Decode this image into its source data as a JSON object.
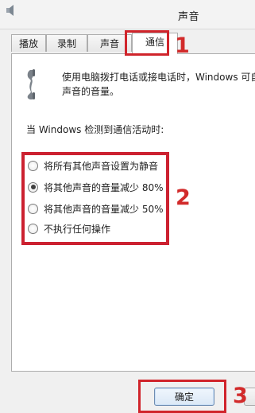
{
  "window": {
    "title": "声音"
  },
  "tabs": [
    {
      "label": "播放"
    },
    {
      "label": "录制"
    },
    {
      "label": "声音"
    },
    {
      "label": "通信"
    }
  ],
  "annotations": {
    "step1": "1",
    "step2": "2",
    "step3": "3"
  },
  "content": {
    "description_line1": "使用电脑拨打电话或接电话时，Windows 可自",
    "description_line2": "声音的音量。",
    "heading": "当 Windows 检测到通信活动时:",
    "options": [
      {
        "label": "将所有其他声音设置为静音",
        "checked": false
      },
      {
        "label": "将其他声音的音量减少 80%",
        "checked": true
      },
      {
        "label": "将其他声音的音量减少 50%",
        "checked": false
      },
      {
        "label": "不执行任何操作",
        "checked": false
      }
    ]
  },
  "footer": {
    "ok_label": "确定"
  },
  "colors": {
    "annotation_red": "#d22b2b",
    "window_bg": "#f0f0f0",
    "panel_bg": "#ffffff"
  },
  "icons": {
    "window": "speaker-icon",
    "communications": "phone-handset-icon"
  }
}
